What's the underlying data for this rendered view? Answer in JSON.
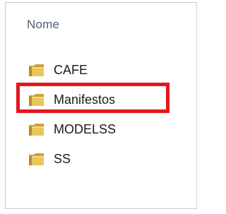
{
  "header": {
    "name_column_label": "Nome"
  },
  "files": [
    {
      "name": "CAFE",
      "icon": "folder-icon"
    },
    {
      "name": "Manifestos",
      "icon": "folder-icon"
    },
    {
      "name": "MODELSS",
      "icon": "folder-icon"
    },
    {
      "name": "SS",
      "icon": "folder-icon"
    }
  ],
  "annotation": {
    "highlight_color": "#e3171e",
    "highlighted_item": "Manifestos"
  },
  "colors": {
    "header_text": "#4c607a",
    "folder_yellow": "#e8c65a",
    "folder_dark": "#c9a23a"
  }
}
